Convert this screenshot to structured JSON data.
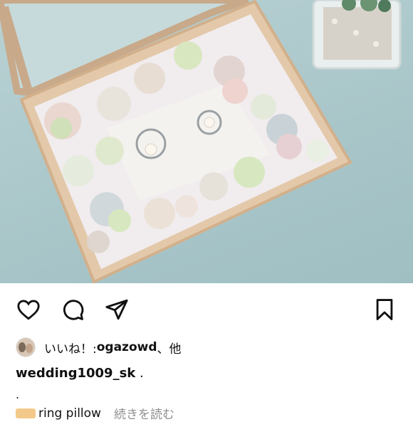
{
  "post": {
    "likes": {
      "prefix": "いいね！: ",
      "user": "ogazowd",
      "suffix": "、他"
    },
    "caption": {
      "user": "wedding1009_sk",
      "text": " ."
    },
    "line2": ".",
    "line3": {
      "hashtag": "ring pillow",
      "more": "続きを読む"
    }
  },
  "icons": {
    "like": "heart-icon",
    "comment": "comment-bubble-icon",
    "share": "paper-plane-icon",
    "save": "bookmark-icon"
  },
  "colors": {
    "text": "#111111",
    "muted": "#8e8e8e",
    "background": "#ffffff"
  }
}
